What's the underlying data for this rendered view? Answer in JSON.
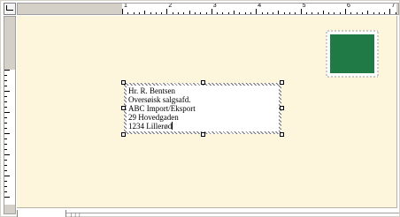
{
  "document": {
    "recipient_address_lines": [
      "Hr. R. Bentsen",
      "Oversøisk salgsafd.",
      "ABC Import/Eksport",
      "29 Hovedgaden",
      "1234 Lillerød"
    ]
  },
  "horizontal_ruler": {
    "labels": [
      "1",
      "2",
      "3",
      "4",
      "5",
      "6",
      "7",
      "8"
    ]
  },
  "stamp": {
    "color": "#1f7a46",
    "icon": "postage-stamp"
  },
  "colors": {
    "envelope": "#fdf6dc",
    "ruler_shade": "#d4d0c8"
  }
}
